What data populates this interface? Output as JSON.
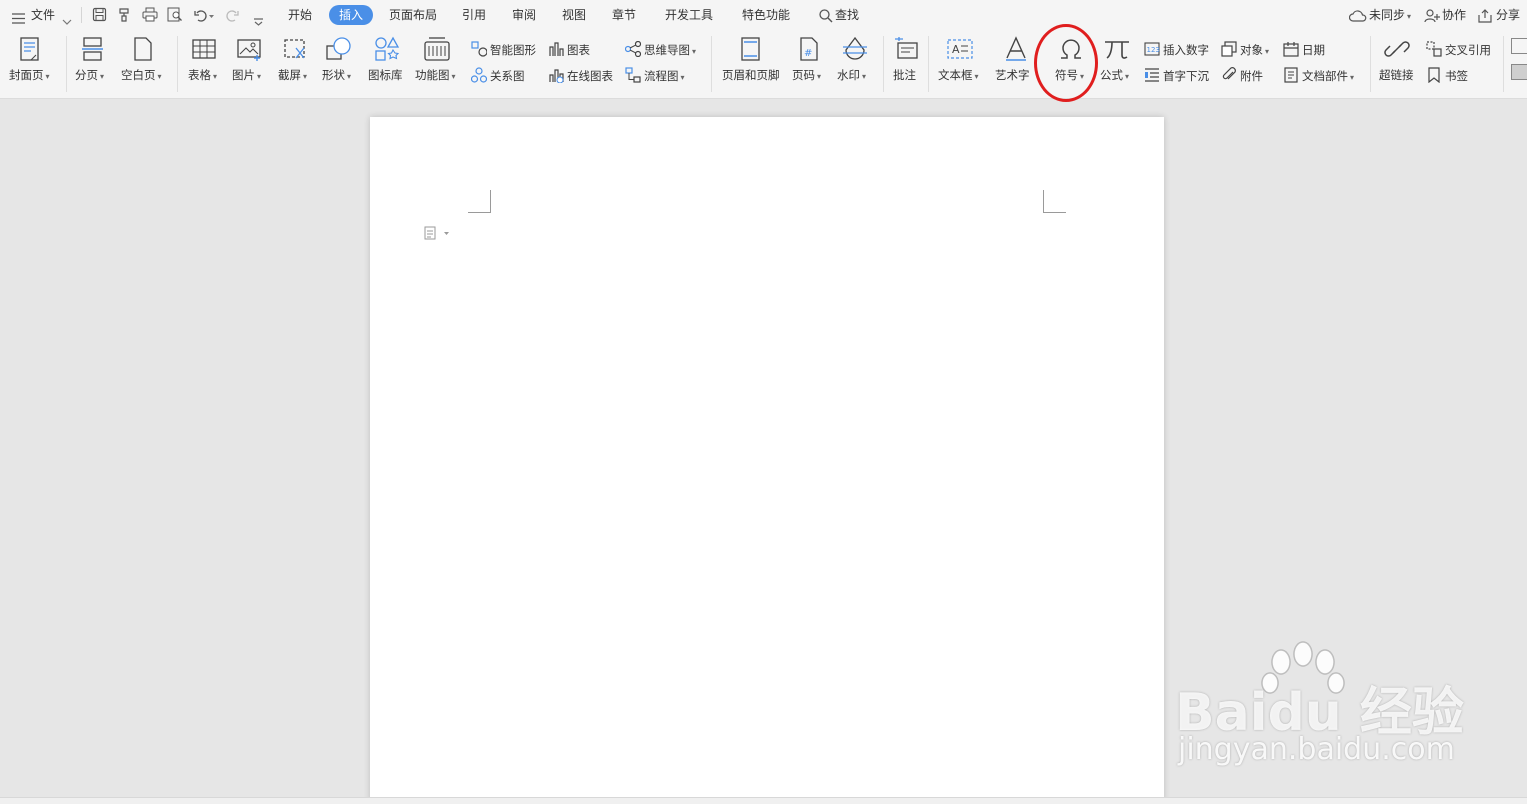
{
  "menubar": {
    "file": "文件",
    "tabs": [
      "开始",
      "插入",
      "页面布局",
      "引用",
      "审阅",
      "视图",
      "章节",
      "开发工具",
      "特色功能"
    ],
    "active_tab": "插入",
    "search": "查找",
    "sync": "未同步",
    "collab": "协作",
    "share": "分享"
  },
  "ribbon": {
    "cover": "封面页",
    "pagebreak": "分页",
    "blank": "空白页",
    "table": "表格",
    "picture": "图片",
    "screenshot": "截屏",
    "shape": "形状",
    "iconlib": "图标库",
    "funcchart": "功能图",
    "smartart": "智能图形",
    "chart": "图表",
    "mindmap": "思维导图",
    "relation": "关系图",
    "onlinechart": "在线图表",
    "flowchart": "流程图",
    "headerfooter": "页眉和页脚",
    "pagenum": "页码",
    "watermark": "水印",
    "comment": "批注",
    "textbox": "文本框",
    "wordart": "艺术字",
    "symbol": "符号",
    "formula": "公式",
    "insertnum": "插入数字",
    "object": "对象",
    "date": "日期",
    "dropcap": "首字下沉",
    "attach": "附件",
    "docpart": "文档部件",
    "hyperlink": "超链接",
    "crossref": "交叉引用",
    "bookmark": "书签"
  },
  "watermark": {
    "brand": "Bai",
    "brand2": "du",
    "cn": "经验",
    "url": "jingyan.baidu.com"
  },
  "colors": {
    "accent": "#4a8fe7",
    "highlight": "#e01e1e"
  }
}
